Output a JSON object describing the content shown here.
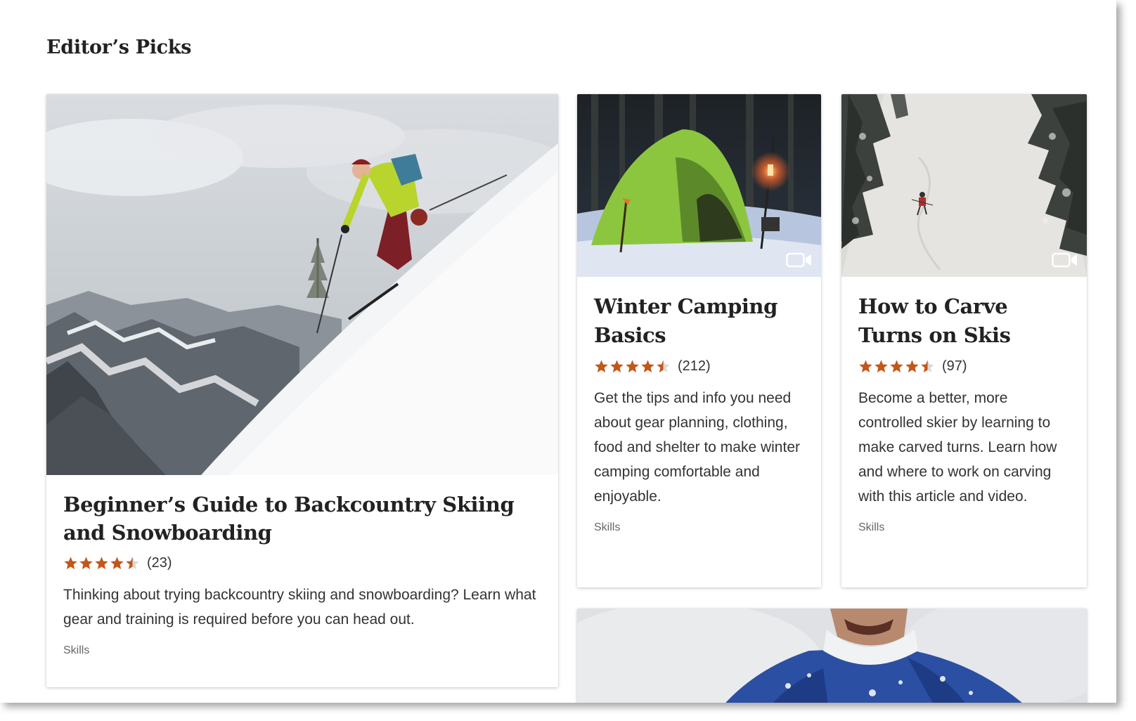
{
  "section": {
    "title": "Editor’s Picks"
  },
  "colors": {
    "star": "#c2571a",
    "star_empty": "#d9d9d9"
  },
  "cards": [
    {
      "title": "Beginner’s Guide to Backcountry Skiing and Snowboarding",
      "rating": 4.5,
      "rating_count": "(23)",
      "description": "Thinking about trying backcountry skiing and snowboarding? Learn what gear and training is required before you can head out.",
      "category": "Skills",
      "has_video": false
    },
    {
      "title": "Winter Camping Basics",
      "rating": 4.5,
      "rating_count": "(212)",
      "description": "Get the tips and info you need about gear planning, clothing, food and shelter to make winter camping comfortable and enjoyable.",
      "category": "Skills",
      "has_video": true
    },
    {
      "title": "How to Carve Turns on Skis",
      "rating": 4.5,
      "rating_count": "(97)",
      "description": "Become a better, more controlled skier by learning to make carved turns. Learn how and where to work on carving with this article and video.",
      "category": "Skills",
      "has_video": true
    }
  ],
  "icons": {
    "video": "video-camera-icon",
    "star": "star-icon"
  }
}
